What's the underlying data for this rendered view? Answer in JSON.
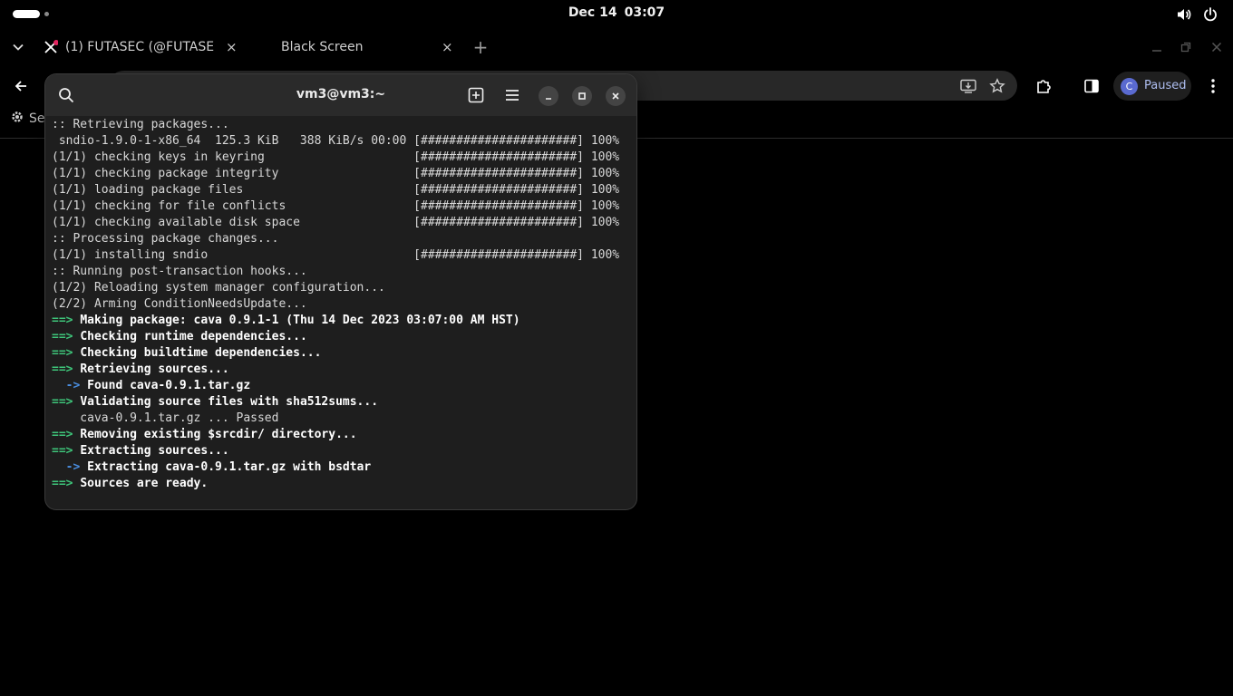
{
  "topbar": {
    "date": "Dec 14",
    "time": "03:07",
    "icons": [
      "activities-indicator",
      "volume-icon",
      "power-icon"
    ]
  },
  "browser": {
    "tabs": [
      {
        "label": "(1) FUTASEC (@FUTASEC",
        "icon": "x-logo-icon",
        "close": "×"
      },
      {
        "label": "Black Screen",
        "close": "×"
      }
    ],
    "new_tab": "+",
    "bookmark_partial": "Se",
    "profile": {
      "initial": "C",
      "label": "Paused"
    }
  },
  "terminal": {
    "title": "vm3@vm3:~",
    "lines": [
      {
        "prefix": "",
        "text": ":: Retrieving packages...",
        "style": "normal"
      },
      {
        "prefix": "",
        "text": " sndio-1.9.0-1-x86_64  125.3 KiB   388 KiB/s 00:00 [######################] 100%",
        "style": "normal"
      },
      {
        "prefix": "",
        "text": "(1/1) checking keys in keyring                     [######################] 100%",
        "style": "normal"
      },
      {
        "prefix": "",
        "text": "(1/1) checking package integrity                   [######################] 100%",
        "style": "normal"
      },
      {
        "prefix": "",
        "text": "(1/1) loading package files                        [######################] 100%",
        "style": "normal"
      },
      {
        "prefix": "",
        "text": "(1/1) checking for file conflicts                  [######################] 100%",
        "style": "normal"
      },
      {
        "prefix": "",
        "text": "(1/1) checking available disk space                [######################] 100%",
        "style": "normal"
      },
      {
        "prefix": "",
        "text": ":: Processing package changes...",
        "style": "normal"
      },
      {
        "prefix": "",
        "text": "(1/1) installing sndio                             [######################] 100%",
        "style": "normal"
      },
      {
        "prefix": "",
        "text": ":: Running post-transaction hooks...",
        "style": "normal"
      },
      {
        "prefix": "",
        "text": "(1/2) Reloading system manager configuration...",
        "style": "normal"
      },
      {
        "prefix": "",
        "text": "(2/2) Arming ConditionNeedsUpdate...",
        "style": "normal"
      },
      {
        "prefix": "==> ",
        "text": "Making package: cava 0.9.1-1 (Thu 14 Dec 2023 03:07:00 AM HST)",
        "style": "green"
      },
      {
        "prefix": "==> ",
        "text": "Checking runtime dependencies...",
        "style": "green"
      },
      {
        "prefix": "==> ",
        "text": "Checking buildtime dependencies...",
        "style": "green"
      },
      {
        "prefix": "==> ",
        "text": "Retrieving sources...",
        "style": "green"
      },
      {
        "prefix": "  -> ",
        "text": "Found cava-0.9.1.tar.gz",
        "style": "blue"
      },
      {
        "prefix": "==> ",
        "text": "Validating source files with sha512sums...",
        "style": "green"
      },
      {
        "prefix": "",
        "text": "    cava-0.9.1.tar.gz ... Passed",
        "style": "normal"
      },
      {
        "prefix": "==> ",
        "text": "Removing existing $srcdir/ directory...",
        "style": "green"
      },
      {
        "prefix": "==> ",
        "text": "Extracting sources...",
        "style": "green"
      },
      {
        "prefix": "  -> ",
        "text": "Extracting cava-0.9.1.tar.gz with bsdtar",
        "style": "blue"
      },
      {
        "prefix": "==> ",
        "text": "Sources are ready.",
        "style": "green"
      }
    ]
  },
  "colors": {
    "terminal_bg": "#1e1e1e",
    "header_bg": "#2a2a2a",
    "arrow_green": "#3ec57a",
    "arrow_blue": "#4a8ee0"
  }
}
